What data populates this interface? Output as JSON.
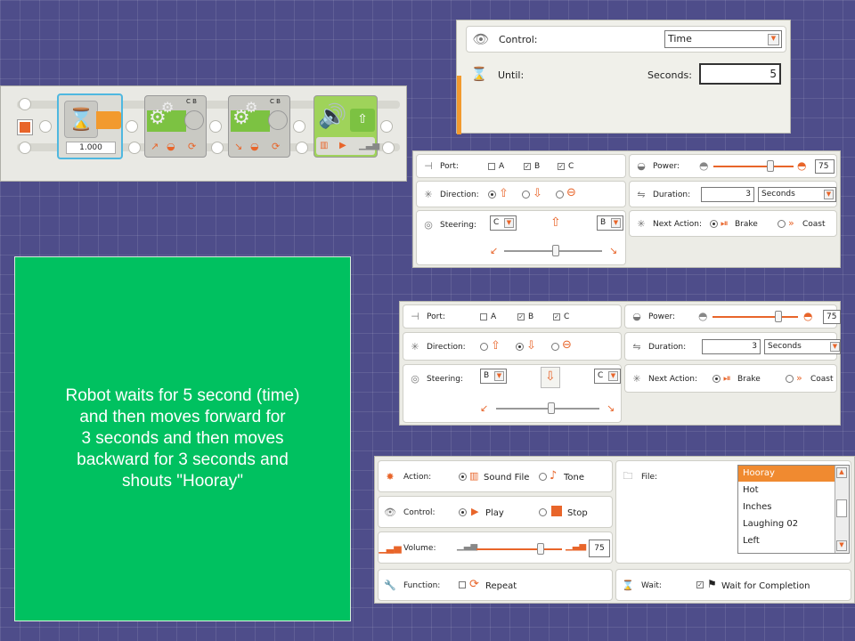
{
  "program_strip": {
    "wait_value": "1.000",
    "motor1_ports": "C B",
    "motor2_ports": "C B"
  },
  "wait_panel": {
    "control_label": "Control:",
    "control_value": "Time",
    "until_label": "Until:",
    "seconds_label": "Seconds:",
    "seconds_value": "5"
  },
  "move1": {
    "port_label": "Port:",
    "port_a": "A",
    "port_b": "B",
    "port_c": "C",
    "direction_label": "Direction:",
    "steering_label": "Steering:",
    "steer_left": "C",
    "steer_right": "B",
    "power_label": "Power:",
    "power_value": "75",
    "duration_label": "Duration:",
    "duration_value": "3",
    "duration_unit": "Seconds",
    "next_action_label": "Next Action:",
    "brake_label": "Brake",
    "coast_label": "Coast"
  },
  "move2": {
    "port_label": "Port:",
    "port_a": "A",
    "port_b": "B",
    "port_c": "C",
    "direction_label": "Direction:",
    "steering_label": "Steering:",
    "steer_left": "B",
    "steer_right": "C",
    "power_label": "Power:",
    "power_value": "75",
    "duration_label": "Duration:",
    "duration_value": "3",
    "duration_unit": "Seconds",
    "next_action_label": "Next Action:",
    "brake_label": "Brake",
    "coast_label": "Coast"
  },
  "sound": {
    "action_label": "Action:",
    "sound_file_label": "Sound File",
    "tone_label": "Tone",
    "control_label": "Control:",
    "play_label": "Play",
    "stop_label": "Stop",
    "volume_label": "Volume:",
    "volume_value": "75",
    "function_label": "Function:",
    "repeat_label": "Repeat",
    "file_label": "File:",
    "files": [
      "Hooray",
      "Hot",
      "Inches",
      "Laughing 02",
      "Left"
    ],
    "wait_label": "Wait:",
    "wait_completion_label": "Wait for Completion"
  },
  "caption": {
    "line1": "Robot waits for 5 second (time)",
    "line2": "and then moves forward for",
    "line3": "3 seconds and then moves",
    "line4": "backward for 3 seconds and",
    "line5": "shouts \"Hooray\""
  },
  "colors": {
    "accent": "#e8652a",
    "caption_bg": "#00c160",
    "block_green": "#7cc242",
    "selected_file": "#f08a30"
  }
}
